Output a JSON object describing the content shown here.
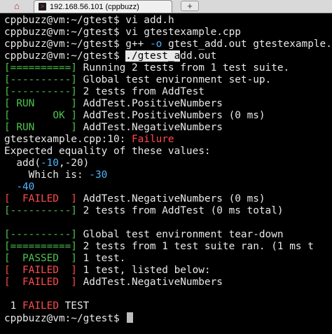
{
  "browser": {
    "tab_title": "192.168.56.101 (cppbuzz)",
    "new_tab_symbol": "+"
  },
  "terminal": {
    "prompt": "cppbuzz@vm:~/gtest$",
    "cmd1": "vi add.h",
    "cmd2": "vi gtestexample.cpp",
    "cmd3_pre": "g++ ",
    "cmd3_flag": "-o",
    "cmd3_post": " gtest_add.out gtestexample.cpp",
    "cmd4_sel": "./gtest_a",
    "cmd4_rest": "dd.out",
    "tag_equals": "[==========]",
    "tag_dashes": "[----------]",
    "tag_run": "[ RUN      ]",
    "tag_ok_open": "[",
    "tag_ok_word": "       OK",
    "tag_ok_close": " ]",
    "tag_failed": "[  FAILED  ]",
    "tag_passed": "[  PASSED  ]",
    "msg_running": " Running 2 tests from 1 test suite.",
    "msg_env_setup": " Global test environment set-up.",
    "msg_tests_from": " 2 tests from AddTest",
    "msg_positive": " AddTest.PositiveNumbers",
    "msg_positive_ok": " AddTest.PositiveNumbers (0 ms)",
    "msg_negative": " AddTest.NegativeNumbers",
    "failure_file": "gtestexample.cpp:10: ",
    "failure_word": "Failure",
    "expected": "Expected equality of these values:",
    "add_pre": "  add(",
    "add_arg1": "-10",
    "add_mid": ",-20)",
    "which_is": "    Which is: ",
    "which_val": "-30",
    "neg40": "  -40",
    "msg_negative_failed": " AddTest.NegativeNumbers (0 ms)",
    "msg_total": " 2 tests from AddTest (0 ms total)",
    "msg_teardown": " Global test environment tear-down",
    "msg_ran": " 2 tests from 1 test suite ran. (1 ms t",
    "msg_one_test": " 1 test.",
    "msg_listed": " 1 test, listed below:",
    "msg_negnum": " AddTest.NegativeNumbers",
    "summary_num": " 1 ",
    "summary_failed": "FAILED",
    "summary_test": " TEST"
  }
}
